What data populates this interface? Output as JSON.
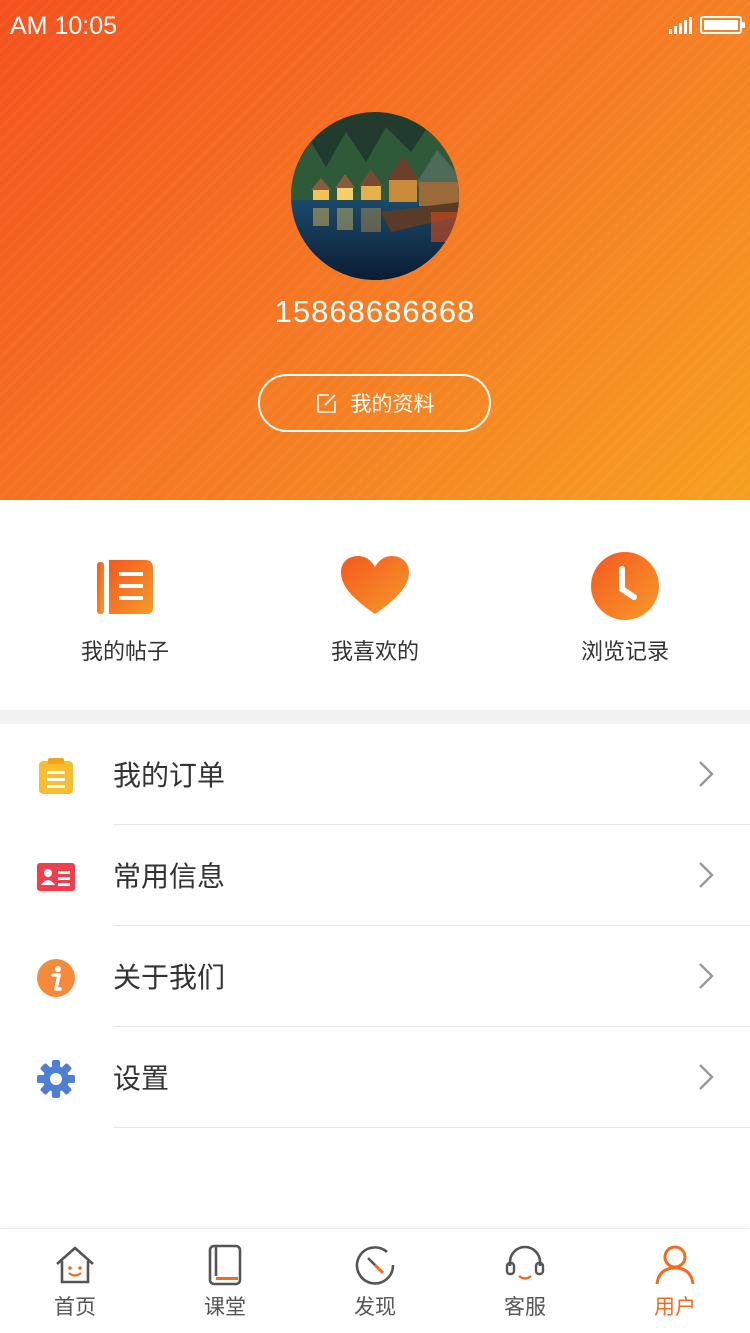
{
  "status_bar": {
    "time": "AM 10:05"
  },
  "profile": {
    "phone": "15868686868",
    "edit_label": "我的资料"
  },
  "quick_actions": [
    {
      "label": "我的帖子",
      "icon": "posts-icon"
    },
    {
      "label": "我喜欢的",
      "icon": "heart-icon"
    },
    {
      "label": "浏览记录",
      "icon": "clock-icon"
    }
  ],
  "menu": [
    {
      "label": "我的订单",
      "icon": "clipboard-icon"
    },
    {
      "label": "常用信息",
      "icon": "id-card-icon"
    },
    {
      "label": "关于我们",
      "icon": "info-icon"
    },
    {
      "label": "设置",
      "icon": "gear-icon"
    }
  ],
  "tabbar": [
    {
      "label": "首页",
      "icon": "home-icon"
    },
    {
      "label": "课堂",
      "icon": "book-icon"
    },
    {
      "label": "发现",
      "icon": "compass-icon"
    },
    {
      "label": "客服",
      "icon": "headset-icon"
    },
    {
      "label": "用户",
      "icon": "user-icon",
      "active": true
    }
  ],
  "colors": {
    "accent": "#f26b21",
    "header_start": "#f5511e",
    "header_end": "#f6a020"
  }
}
